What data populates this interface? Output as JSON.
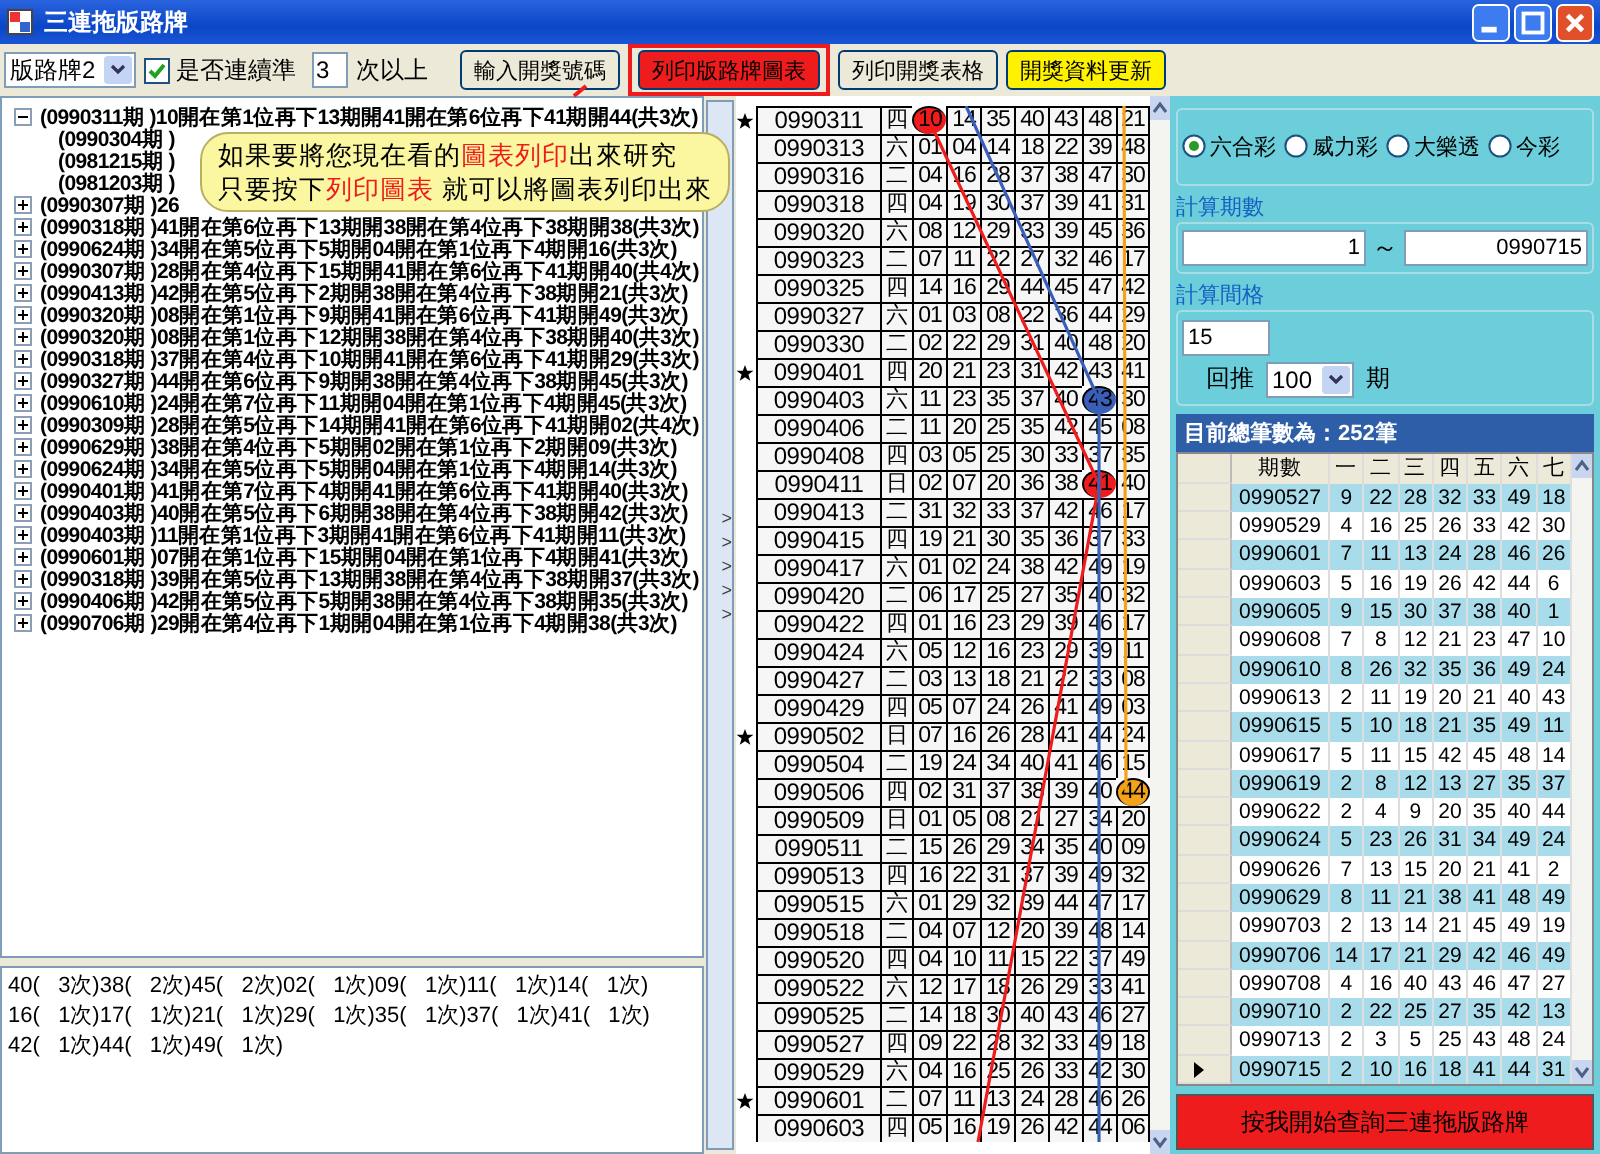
{
  "window": {
    "title": "三連拖版路牌"
  },
  "toolbar": {
    "board_select": "版路牌2",
    "consecutive": {
      "label": "是否連續準",
      "checked": true
    },
    "times_value": "3",
    "times_label": "次以上",
    "buttons": [
      {
        "label": "輸入開獎號碼",
        "color": "#ece9d8",
        "highlighted": false
      },
      {
        "label": "列印版路牌圖表",
        "color": "#ee1c1c",
        "highlighted": true
      },
      {
        "label": "列印開獎表格",
        "color": "#ece9d8",
        "highlighted": false
      },
      {
        "label": "開獎資料更新",
        "color": "#fff200",
        "highlighted": false
      }
    ]
  },
  "callout": {
    "lines": [
      [
        {
          "text": "如果要將您現在看的",
          "emphasis": false
        },
        {
          "text": "圖表列印",
          "emphasis": true
        },
        {
          "text": "出來研究",
          "emphasis": false
        }
      ],
      [
        {
          "text": "只要按下",
          "emphasis": false
        },
        {
          "text": "列印圖表",
          "emphasis": true
        },
        {
          "text": " 就可以將圖表列印出來",
          "emphasis": false
        }
      ]
    ]
  },
  "tree": [
    {
      "label": "(0990311期 )10開在第1位再下13期開41開在第6位再下41期開44(共3次)",
      "expanded": true,
      "children": [
        {
          "label": "(0990304期 )"
        },
        {
          "label": "(0981215期 )"
        },
        {
          "label": "(0981203期 )"
        }
      ]
    },
    {
      "label": "(0990307期 )26",
      "expanded": false
    },
    {
      "label": "(0990318期 )41開在第6位再下13期開38開在第4位再下38期開38(共3次)",
      "expanded": false
    },
    {
      "label": "(0990624期 )34開在第5位再下5期開04開在第1位再下4期開16(共3次)",
      "expanded": false
    },
    {
      "label": "(0990307期 )28開在第4位再下15期開41開在第6位再下41期開40(共4次)",
      "expanded": false
    },
    {
      "label": "(0990413期 )42開在第5位再下2期開38開在第4位再下38期開21(共3次)",
      "expanded": false
    },
    {
      "label": "(0990320期 )08開在第1位再下9期開41開在第6位再下41期開49(共3次)",
      "expanded": false
    },
    {
      "label": "(0990320期 )08開在第1位再下12期開38開在第4位再下38期開40(共3次)",
      "expanded": false
    },
    {
      "label": "(0990318期 )37開在第4位再下10期開41開在第6位再下41期開29(共3次)",
      "expanded": false
    },
    {
      "label": "(0990327期 )44開在第6位再下9期開38開在第4位再下38期開45(共3次)",
      "expanded": false
    },
    {
      "label": "(0990610期 )24開在第7位再下11期開04開在第1位再下4期開45(共3次)",
      "expanded": false
    },
    {
      "label": "(0990309期 )28開在第5位再下14期開41開在第6位再下41期開02(共4次)",
      "expanded": false
    },
    {
      "label": "(0990629期 )38開在第4位再下5期開02開在第1位再下2期開09(共3次)",
      "expanded": false
    },
    {
      "label": "(0990624期 )34開在第5位再下5期開04開在第1位再下4期開14(共3次)",
      "expanded": false
    },
    {
      "label": "(0990401期 )41開在第7位再下4期開41開在第6位再下41期開40(共3次)",
      "expanded": false
    },
    {
      "label": "(0990403期 )40開在第5位再下6期開38開在第4位再下38期開42(共3次)",
      "expanded": false
    },
    {
      "label": "(0990403期 )11開在第1位再下3期開41開在第6位再下41期開11(共3次)",
      "expanded": false
    },
    {
      "label": "(0990601期 )07開在第1位再下15期開04開在第1位再下4期開41(共3次)",
      "expanded": false
    },
    {
      "label": "(0990318期 )39開在第5位再下13期開38開在第4位再下38期開37(共3次)",
      "expanded": false
    },
    {
      "label": "(0990406期 )42開在第5位再下5期開38開在第4位再下38期開35(共3次)",
      "expanded": false
    },
    {
      "label": "(0990706期 )29開在第4位再下1期開04開在第1位再下4期開38(共3次)",
      "expanded": false
    }
  ],
  "summary": [
    "40(   3次)38(   2次)45(   2次)02(   1次)09(   1次)11(   1次)14(   1次)",
    "16(   1次)17(   1次)21(   1次)29(   1次)35(   1次)37(   1次)41(   1次)",
    "42(   1次)44(   1次)49(   1次)"
  ],
  "splitter_marks": [
    ">",
    ">",
    ">",
    ">",
    ">"
  ],
  "grid": [
    {
      "period": "0990311",
      "day": "四",
      "starred": true,
      "numbers": [
        {
          "value": "10",
          "color": "#ee1c1c"
        },
        "14",
        "35",
        "40",
        "43",
        "48",
        "21"
      ]
    },
    {
      "period": "0990313",
      "day": "六",
      "starred": false,
      "numbers": [
        "01",
        "04",
        "14",
        "18",
        "22",
        "39",
        "48"
      ]
    },
    {
      "period": "0990316",
      "day": "二",
      "starred": false,
      "numbers": [
        "04",
        "16",
        "28",
        "37",
        "38",
        "47",
        "30"
      ]
    },
    {
      "period": "0990318",
      "day": "四",
      "starred": false,
      "numbers": [
        "04",
        "19",
        "30",
        "37",
        "39",
        "41",
        "31"
      ]
    },
    {
      "period": "0990320",
      "day": "六",
      "starred": false,
      "numbers": [
        "08",
        "12",
        "29",
        "33",
        "39",
        "45",
        "36"
      ]
    },
    {
      "period": "0990323",
      "day": "二",
      "starred": false,
      "numbers": [
        "07",
        "11",
        "22",
        "27",
        "32",
        "46",
        "17"
      ]
    },
    {
      "period": "0990325",
      "day": "四",
      "starred": false,
      "numbers": [
        "14",
        "16",
        "29",
        "44",
        "45",
        "47",
        "42"
      ]
    },
    {
      "period": "0990327",
      "day": "六",
      "starred": false,
      "numbers": [
        "01",
        "03",
        "08",
        "22",
        "36",
        "44",
        "29"
      ]
    },
    {
      "period": "0990330",
      "day": "二",
      "starred": false,
      "numbers": [
        "02",
        "22",
        "29",
        "31",
        "40",
        "48",
        "20"
      ]
    },
    {
      "period": "0990401",
      "day": "四",
      "starred": true,
      "numbers": [
        "20",
        "21",
        "23",
        "31",
        "42",
        "43",
        "41"
      ]
    },
    {
      "period": "0990403",
      "day": "六",
      "starred": false,
      "numbers": [
        "11",
        "23",
        "35",
        "37",
        "40",
        {
          "value": "43",
          "color": "#3a5fb8"
        },
        "30"
      ]
    },
    {
      "period": "0990406",
      "day": "二",
      "starred": false,
      "numbers": [
        "11",
        "20",
        "25",
        "35",
        "42",
        "45",
        "08"
      ]
    },
    {
      "period": "0990408",
      "day": "四",
      "starred": false,
      "numbers": [
        "03",
        "05",
        "25",
        "30",
        "33",
        "37",
        "35"
      ]
    },
    {
      "period": "0990411",
      "day": "日",
      "starred": false,
      "numbers": [
        "02",
        "07",
        "20",
        "36",
        "38",
        {
          "value": "41",
          "color": "#ee1c1c"
        },
        "40"
      ]
    },
    {
      "period": "0990413",
      "day": "二",
      "starred": false,
      "numbers": [
        "31",
        "32",
        "33",
        "37",
        "42",
        "46",
        "17"
      ]
    },
    {
      "period": "0990415",
      "day": "四",
      "starred": false,
      "numbers": [
        "19",
        "21",
        "30",
        "35",
        "36",
        "37",
        "33"
      ]
    },
    {
      "period": "0990417",
      "day": "六",
      "starred": false,
      "numbers": [
        "01",
        "02",
        "24",
        "38",
        "42",
        "49",
        "19"
      ]
    },
    {
      "period": "0990420",
      "day": "二",
      "starred": false,
      "numbers": [
        "06",
        "17",
        "25",
        "27",
        "35",
        "40",
        "32"
      ]
    },
    {
      "period": "0990422",
      "day": "四",
      "starred": false,
      "numbers": [
        "01",
        "16",
        "23",
        "29",
        "39",
        "46",
        "17"
      ]
    },
    {
      "period": "0990424",
      "day": "六",
      "starred": false,
      "numbers": [
        "05",
        "12",
        "16",
        "23",
        "29",
        "39",
        "11"
      ]
    },
    {
      "period": "0990427",
      "day": "二",
      "starred": false,
      "numbers": [
        "03",
        "13",
        "18",
        "21",
        "22",
        "33",
        "08"
      ]
    },
    {
      "period": "0990429",
      "day": "四",
      "starred": false,
      "numbers": [
        "05",
        "07",
        "24",
        "26",
        "41",
        "49",
        "03"
      ]
    },
    {
      "period": "0990502",
      "day": "日",
      "starred": true,
      "numbers": [
        "07",
        "16",
        "26",
        "28",
        "41",
        "44",
        "24"
      ]
    },
    {
      "period": "0990504",
      "day": "二",
      "starred": false,
      "numbers": [
        "19",
        "24",
        "34",
        "40",
        "41",
        "46",
        "15"
      ]
    },
    {
      "period": "0990506",
      "day": "四",
      "starred": false,
      "numbers": [
        "02",
        "31",
        "37",
        "38",
        "39",
        "40",
        {
          "value": "44",
          "color": "#f5a21b"
        }
      ]
    },
    {
      "period": "0990509",
      "day": "日",
      "starred": false,
      "numbers": [
        "01",
        "05",
        "08",
        "21",
        "27",
        "34",
        "20"
      ]
    },
    {
      "period": "0990511",
      "day": "二",
      "starred": false,
      "numbers": [
        "15",
        "26",
        "29",
        "34",
        "35",
        "40",
        "09"
      ]
    },
    {
      "period": "0990513",
      "day": "四",
      "starred": false,
      "numbers": [
        "16",
        "22",
        "31",
        "37",
        "39",
        "49",
        "32"
      ]
    },
    {
      "period": "0990515",
      "day": "六",
      "starred": false,
      "numbers": [
        "01",
        "29",
        "32",
        "39",
        "44",
        "47",
        "17"
      ]
    },
    {
      "period": "0990518",
      "day": "二",
      "starred": false,
      "numbers": [
        "04",
        "07",
        "12",
        "20",
        "39",
        "48",
        "14"
      ]
    },
    {
      "period": "0990520",
      "day": "四",
      "starred": false,
      "numbers": [
        "04",
        "10",
        "11",
        "15",
        "22",
        "37",
        "49"
      ]
    },
    {
      "period": "0990522",
      "day": "六",
      "starred": false,
      "numbers": [
        "12",
        "17",
        "18",
        "26",
        "29",
        "33",
        "41"
      ]
    },
    {
      "period": "0990525",
      "day": "二",
      "starred": false,
      "numbers": [
        "14",
        "18",
        "30",
        "40",
        "43",
        "46",
        "27"
      ]
    },
    {
      "period": "0990527",
      "day": "四",
      "starred": false,
      "numbers": [
        "09",
        "22",
        "28",
        "32",
        "33",
        "49",
        "18"
      ]
    },
    {
      "period": "0990529",
      "day": "六",
      "starred": false,
      "numbers": [
        "04",
        "16",
        "25",
        "26",
        "33",
        "42",
        "30"
      ]
    },
    {
      "period": "0990601",
      "day": "二",
      "starred": true,
      "numbers": [
        "07",
        "11",
        "13",
        "24",
        "28",
        "46",
        "26"
      ]
    },
    {
      "period": "0990603",
      "day": "四",
      "starred": false,
      "numbers": [
        "05",
        "16",
        "19",
        "26",
        "42",
        "44",
        "06"
      ]
    }
  ],
  "lottery_types": [
    {
      "label": "六合彩",
      "selected": true
    },
    {
      "label": "威力彩",
      "selected": false
    },
    {
      "label": "大樂透",
      "selected": false
    },
    {
      "label": "今彩",
      "selected": false
    }
  ],
  "period_range": {
    "title": "計算期數",
    "from": "1",
    "separator": "～",
    "to": "0990715"
  },
  "interval": {
    "title": "計算間格",
    "value": "15",
    "back_label": "回推",
    "back_value": "100",
    "unit": "期"
  },
  "table": {
    "total": "目前總筆數為：252筆",
    "columns": [
      "期數",
      "一",
      "二",
      "三",
      "四",
      "五",
      "六",
      "七"
    ],
    "rows": [
      {
        "cells": [
          "0990527",
          "9",
          "22",
          "28",
          "32",
          "33",
          "49",
          "18"
        ],
        "selected": false
      },
      {
        "cells": [
          "0990529",
          "4",
          "16",
          "25",
          "26",
          "33",
          "42",
          "30"
        ],
        "selected": false
      },
      {
        "cells": [
          "0990601",
          "7",
          "11",
          "13",
          "24",
          "28",
          "46",
          "26"
        ],
        "selected": false
      },
      {
        "cells": [
          "0990603",
          "5",
          "16",
          "19",
          "26",
          "42",
          "44",
          "6"
        ],
        "selected": false
      },
      {
        "cells": [
          "0990605",
          "9",
          "15",
          "30",
          "37",
          "38",
          "40",
          "1"
        ],
        "selected": false
      },
      {
        "cells": [
          "0990608",
          "7",
          "8",
          "12",
          "21",
          "23",
          "47",
          "10"
        ],
        "selected": false
      },
      {
        "cells": [
          "0990610",
          "8",
          "26",
          "32",
          "35",
          "36",
          "49",
          "24"
        ],
        "selected": false
      },
      {
        "cells": [
          "0990613",
          "2",
          "11",
          "19",
          "20",
          "21",
          "40",
          "43"
        ],
        "selected": false
      },
      {
        "cells": [
          "0990615",
          "5",
          "10",
          "18",
          "21",
          "35",
          "49",
          "11"
        ],
        "selected": false
      },
      {
        "cells": [
          "0990617",
          "5",
          "11",
          "15",
          "42",
          "45",
          "48",
          "14"
        ],
        "selected": false
      },
      {
        "cells": [
          "0990619",
          "2",
          "8",
          "12",
          "13",
          "27",
          "35",
          "37"
        ],
        "selected": false
      },
      {
        "cells": [
          "0990622",
          "2",
          "4",
          "9",
          "20",
          "35",
          "40",
          "44"
        ],
        "selected": false
      },
      {
        "cells": [
          "0990624",
          "5",
          "23",
          "26",
          "31",
          "34",
          "49",
          "24"
        ],
        "selected": false
      },
      {
        "cells": [
          "0990626",
          "7",
          "13",
          "15",
          "20",
          "21",
          "41",
          "2"
        ],
        "selected": false
      },
      {
        "cells": [
          "0990629",
          "8",
          "11",
          "21",
          "38",
          "41",
          "48",
          "49"
        ],
        "selected": false
      },
      {
        "cells": [
          "0990703",
          "2",
          "13",
          "14",
          "21",
          "45",
          "49",
          "19"
        ],
        "selected": false
      },
      {
        "cells": [
          "0990706",
          "14",
          "17",
          "21",
          "29",
          "42",
          "46",
          "49"
        ],
        "selected": false
      },
      {
        "cells": [
          "0990708",
          "4",
          "16",
          "40",
          "43",
          "46",
          "47",
          "27"
        ],
        "selected": false
      },
      {
        "cells": [
          "0990710",
          "2",
          "22",
          "25",
          "27",
          "35",
          "42",
          "13"
        ],
        "selected": false
      },
      {
        "cells": [
          "0990713",
          "2",
          "3",
          "5",
          "25",
          "43",
          "48",
          "24"
        ],
        "selected": false
      },
      {
        "cells": [
          "0990715",
          "2",
          "10",
          "16",
          "18",
          "41",
          "44",
          "31"
        ],
        "selected": true
      }
    ]
  },
  "query_button": "按我開始查詢三連拖版路牌"
}
